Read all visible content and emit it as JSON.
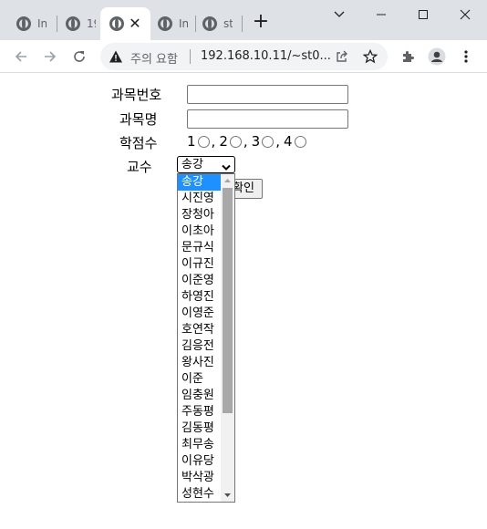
{
  "browser": {
    "tabs": [
      {
        "title": "In"
      },
      {
        "title": "19"
      },
      {
        "title": "",
        "active": true
      },
      {
        "title": "In"
      },
      {
        "title": "st"
      }
    ],
    "new_tab": "+",
    "tab_close": "✕",
    "window_controls": {
      "minimize": "minimize-icon",
      "maximize": "maximize-icon",
      "close": "close-icon"
    },
    "address": {
      "warning": "주의 요함",
      "url": "192.168.10.11/~st0..."
    },
    "icons": [
      "back-arrow-icon",
      "forward-arrow-icon",
      "reload-icon",
      "warning-triangle-icon",
      "share-icon",
      "bookmark-star-icon",
      "extensions-icon",
      "profile-icon",
      "menu-icon"
    ]
  },
  "form": {
    "course_number_label": "과목번호",
    "course_number_value": "",
    "course_name_label": "과목명",
    "course_name_value": "",
    "credits_label": "학점수",
    "credit_options": [
      "1",
      "2",
      "3",
      "4"
    ],
    "professor_label": "교수",
    "professor_selected": "송강",
    "submit_label": "확인",
    "professor_options": [
      "송강",
      "시진영",
      "장청아",
      "이초아",
      "문규식",
      "이규진",
      "이준영",
      "하영진",
      "이영준",
      "호연작",
      "김응전",
      "왕사진",
      "이준",
      "임충원",
      "주동평",
      "김동평",
      "최무송",
      "이유당",
      "박삭광",
      "성현수"
    ]
  },
  "colors": {
    "selected_option_bg": "#1e90ff",
    "tabstrip_bg": "#dee1e6"
  }
}
